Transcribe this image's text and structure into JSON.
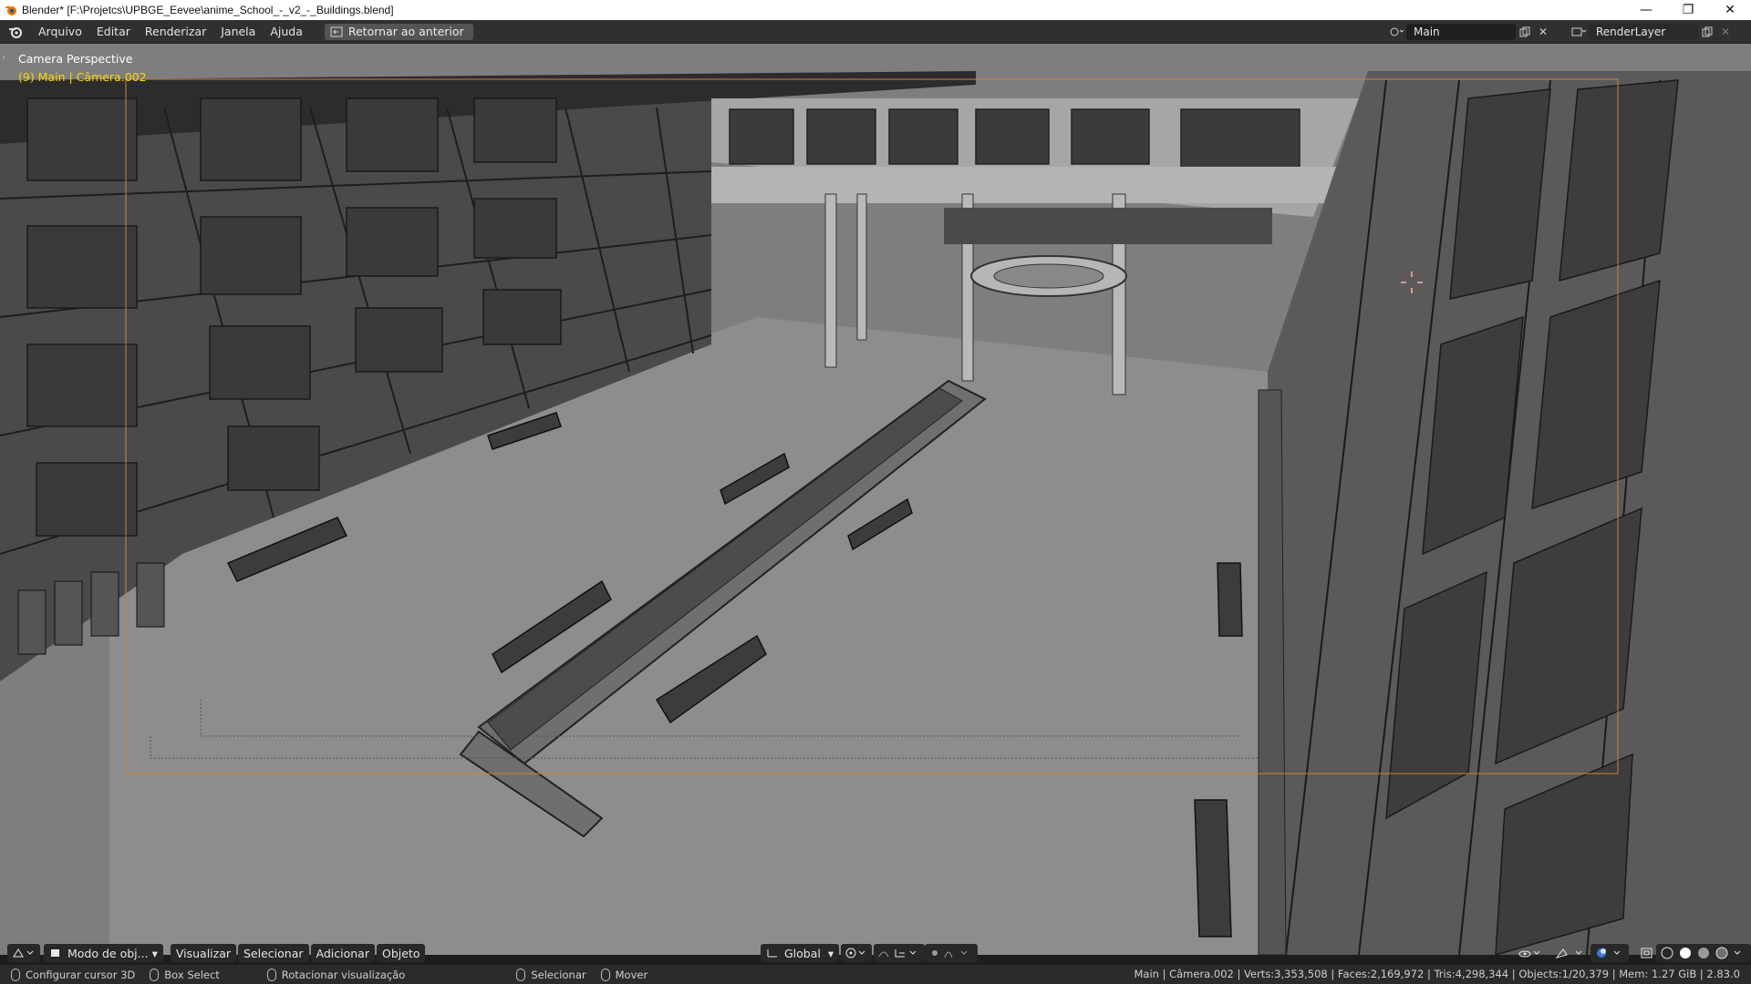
{
  "window": {
    "title": "Blender* [F:\\Projetcs\\UPBGE_Eevee\\anime_School_-_v2_-_Buildings.blend]",
    "controls": [
      "—",
      "❐",
      "✕"
    ]
  },
  "menubar": {
    "items": [
      "Arquivo",
      "Editar",
      "Renderizar",
      "Janela",
      "Ajuda"
    ],
    "back_button": "Retornar ao anterior",
    "scene_name": "Main",
    "view_layer": "RenderLayer"
  },
  "viewport": {
    "view_label": "Camera Perspective",
    "object_label": "(9) Main | Câmera.002"
  },
  "header3d": {
    "mode": "Modo de obj...",
    "menus": [
      "Visualizar",
      "Selecionar",
      "Adicionar",
      "Objeto"
    ],
    "orientation": "Global"
  },
  "statusbar": {
    "items": [
      "Configurar cursor 3D",
      "Box Select",
      "Rotacionar visualização",
      "Selecionar",
      "Mover"
    ],
    "stats": "Main | Câmera.002 | Verts:3,353,508 | Faces:2,169,972 | Tris:4,298,344 | Objects:1/20,379 | Mem: 1.27 GiB | 2.83.0"
  },
  "colors": {
    "accent": "#ffd700",
    "camera_frame": "#c8873a",
    "panel": "#303030"
  }
}
